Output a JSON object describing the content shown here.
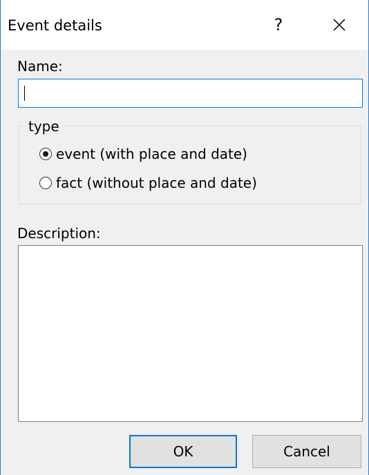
{
  "dialog": {
    "title": "Event details",
    "help_label": "?",
    "close_icon": "close-icon"
  },
  "name_field": {
    "label": "Name:",
    "value": ""
  },
  "type_group": {
    "legend": "type",
    "options": [
      {
        "label": "event (with place and date)",
        "selected": true
      },
      {
        "label": "fact (without place and date)",
        "selected": false
      }
    ]
  },
  "description_field": {
    "label": "Description:",
    "value": ""
  },
  "buttons": {
    "ok_label": "OK",
    "cancel_label": "Cancel"
  },
  "colors": {
    "accent": "#0078d7",
    "window_border": "#2b79d4",
    "dialog_bg": "#f0f0f0",
    "button_bg": "#e1e1e1"
  }
}
